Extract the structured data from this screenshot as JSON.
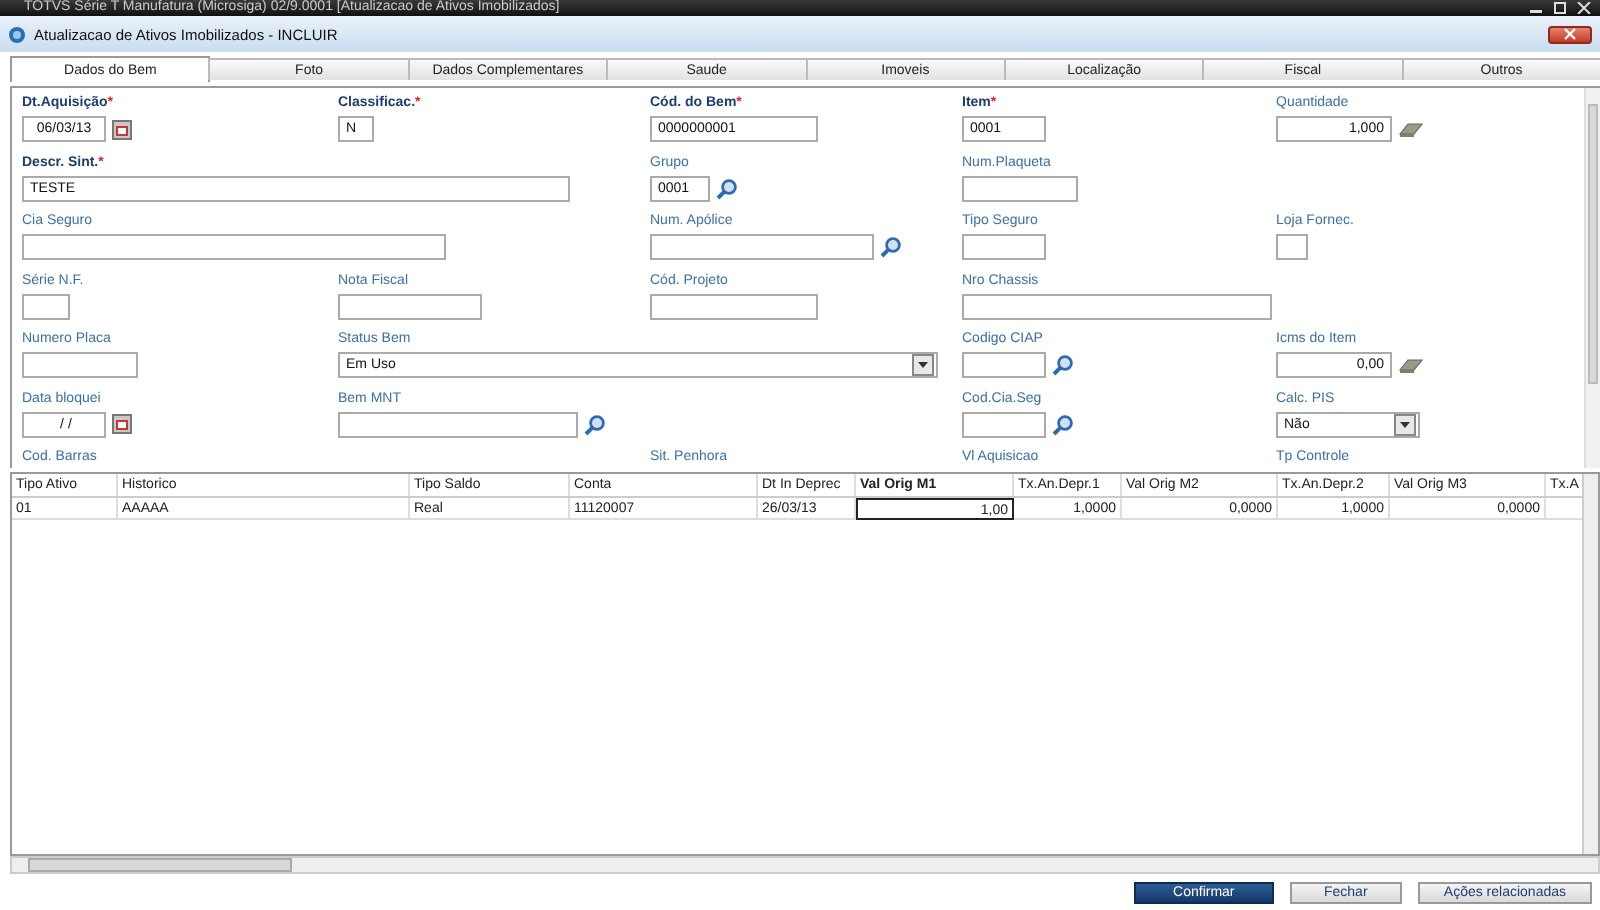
{
  "os_title": "TOTVS Série T Manufatura (Microsiga) 02/9.0001 [Atualizacao de Ativos Imobilizados]",
  "window": {
    "title": "Atualizacao de Ativos Imobilizados - INCLUIR"
  },
  "tabs": [
    {
      "label": "Dados do Bem",
      "selected": true
    },
    {
      "label": "Foto",
      "selected": false
    },
    {
      "label": "Dados Complementares",
      "selected": false
    },
    {
      "label": "Saude",
      "selected": false
    },
    {
      "label": "Imoveis",
      "selected": false
    },
    {
      "label": "Localização",
      "selected": false
    },
    {
      "label": "Fiscal",
      "selected": false
    },
    {
      "label": "Outros",
      "selected": false
    }
  ],
  "form_rows": [
    [
      {
        "label": "Dt.Aquisição",
        "required_mark": "*",
        "kind": "date",
        "value": "06/03/13"
      },
      {
        "label": "Classificac.",
        "required_mark": "*",
        "kind": "text",
        "value": "N"
      },
      {
        "label": "Cód. do Bem",
        "required_mark": "*",
        "kind": "text",
        "value": "0000000001"
      },
      {
        "label": "Item",
        "required_mark": "*",
        "kind": "text",
        "value": "0001"
      },
      {
        "label": "Quantidade",
        "kind": "number",
        "value": "1,000"
      }
    ],
    [
      {
        "label": "Descr. Sint.",
        "required_mark": "*",
        "kind": "text",
        "value": "TESTE"
      },
      {
        "label": "Grupo",
        "kind": "lookup",
        "value": "0001"
      },
      {
        "label": "Num.Plaqueta",
        "kind": "text"
      },
      null
    ],
    [
      {
        "label": "Cia Seguro",
        "kind": "text"
      },
      {
        "label": "Num. Apólice",
        "kind": "lookup"
      },
      {
        "label": "Tipo Seguro",
        "kind": "text"
      },
      {
        "label": "Loja Fornec.",
        "kind": "text"
      }
    ],
    [
      {
        "label": "Série N.F.",
        "kind": "text"
      },
      {
        "label": "Nota Fiscal",
        "kind": "text"
      },
      {
        "label": "Cód. Projeto",
        "kind": "text"
      },
      {
        "label": "Nro Chassis",
        "kind": "text"
      },
      null
    ],
    [
      {
        "label": "Numero Placa",
        "kind": "text"
      },
      {
        "label": "Status Bem",
        "kind": "combo",
        "value": "Em Uso"
      },
      {
        "label": "Codigo CIAP",
        "kind": "lookup"
      },
      {
        "label": "Icms do Item",
        "kind": "number",
        "value": "0,00"
      }
    ],
    [
      {
        "label": "Data bloquei",
        "kind": "date",
        "value": " / /"
      },
      {
        "label": "Bem MNT",
        "kind": "lookup"
      },
      null,
      {
        "label": "Cod.Cia.Seg",
        "kind": "lookup"
      },
      {
        "label": "Calc. PIS",
        "kind": "combo",
        "value": "Não"
      }
    ],
    [
      {
        "label": "Cod. Barras",
        "kind": "label"
      },
      null,
      {
        "label": "Sit. Penhora",
        "kind": "label"
      },
      {
        "label": "Vl Aquisicao",
        "kind": "label"
      },
      {
        "label": "Tp Controle",
        "kind": "label"
      }
    ]
  ],
  "table": {
    "columns": [
      {
        "label": "Tipo Ativo",
        "kind": "text",
        "selected": false
      },
      {
        "label": "Historico",
        "kind": "text",
        "selected": false
      },
      {
        "label": "Tipo Saldo",
        "kind": "text",
        "selected": false
      },
      {
        "label": "Conta",
        "kind": "text",
        "selected": false
      },
      {
        "label": "Dt In Deprec",
        "kind": "text",
        "selected": false
      },
      {
        "label": "Val Orig M1",
        "kind": "number",
        "selected": true
      },
      {
        "label": "Tx.An.Depr.1",
        "kind": "number",
        "selected": false
      },
      {
        "label": "Val Orig M2",
        "kind": "number",
        "selected": false
      },
      {
        "label": "Tx.An.Depr.2",
        "kind": "number",
        "selected": false
      },
      {
        "label": "Val Orig M3",
        "kind": "number",
        "selected": false
      },
      {
        "label": "Tx.A",
        "kind": "number",
        "selected": false
      }
    ],
    "rows": [
      [
        "01",
        "AAAAA",
        "Real",
        "11120007",
        "26/03/13",
        "1,00",
        "1,0000",
        "0,0000",
        "1,0000",
        "0,0000",
        null
      ]
    ]
  },
  "buttons": [
    {
      "label": "Confirmar",
      "kind": "primary"
    },
    {
      "label": "Fechar",
      "kind": "secondary"
    },
    {
      "label": "Ações relacionadas",
      "kind": "secondary"
    }
  ]
}
